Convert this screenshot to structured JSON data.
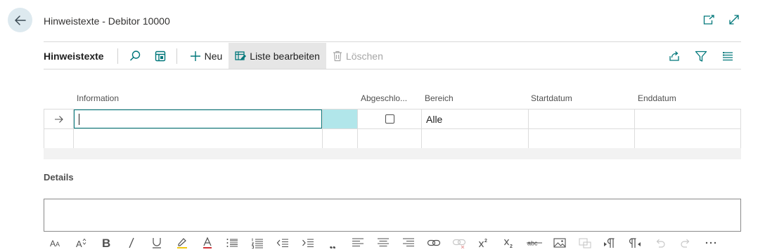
{
  "page": {
    "title": "Hinweistexte - Debitor 10000"
  },
  "actionbar": {
    "title": "Hinweistexte",
    "new_label": "Neu",
    "edit_list_label": "Liste bearbeiten",
    "delete_label": "Löschen"
  },
  "grid": {
    "columns": {
      "information": "Information",
      "abgeschlossen": "Abgeschlo...",
      "bereich": "Bereich",
      "startdatum": "Startdatum",
      "enddatum": "Enddatum"
    },
    "rows": [
      {
        "information": "",
        "abgeschlossen": false,
        "bereich": "Alle",
        "startdatum": "",
        "enddatum": ""
      },
      {
        "information": "",
        "abgeschlossen": null,
        "bereich": "",
        "startdatum": "",
        "enddatum": ""
      }
    ]
  },
  "details": {
    "label": "Details"
  },
  "colors": {
    "accent_teal": "#00777a",
    "selection_cyan": "#b1e6ea",
    "back_button_bg": "#dde9ef"
  },
  "icons": {
    "toolbar": [
      "font-size-icon",
      "font-resize-icon",
      "bold-icon",
      "italic-icon",
      "underline-icon",
      "highlight-icon",
      "font-color-icon",
      "bullet-list-icon",
      "numbered-list-icon",
      "decrease-indent-icon",
      "increase-indent-icon",
      "quote-icon",
      "align-left-icon",
      "align-center-icon",
      "align-right-icon",
      "link-icon",
      "unlink-icon",
      "superscript-icon",
      "subscript-icon",
      "strikethrough-icon",
      "image-icon",
      "image-disabled-icon",
      "ltr-icon",
      "rtl-icon",
      "undo-icon",
      "redo-icon",
      "more-icon"
    ]
  }
}
